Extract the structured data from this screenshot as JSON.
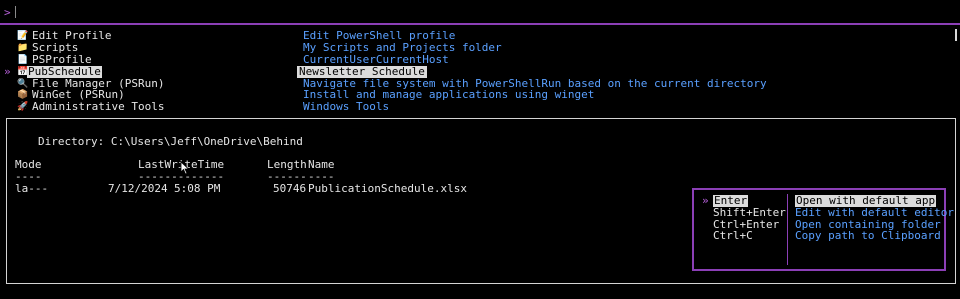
{
  "prompt": {
    "symbol": ">",
    "value": ""
  },
  "entries": [
    {
      "icon": "📝",
      "icon_name": "memo-icon",
      "name": "Edit Profile",
      "description": "Edit PowerShell profile",
      "selected": false
    },
    {
      "icon": "📁",
      "icon_name": "folder-icon",
      "name": "Scripts",
      "description": "My Scripts and Projects folder",
      "selected": false
    },
    {
      "icon": "📄",
      "icon_name": "page-icon",
      "name": "PSProfile",
      "description": "CurrentUserCurrentHost",
      "selected": false
    },
    {
      "icon": "📅",
      "icon_name": "calendar-icon",
      "name": "PubSchedule",
      "description": "Newsletter Schedule",
      "selected": true
    },
    {
      "icon": "🔍",
      "icon_name": "magnifier-icon",
      "name": "File Manager (PSRun)",
      "description": "Navigate file system with PowerShellRun based on the current directory",
      "selected": false
    },
    {
      "icon": "📦",
      "icon_name": "package-icon",
      "name": "WinGet (PSRun)",
      "description": "Install and manage applications using winget",
      "selected": false
    },
    {
      "icon": "🚀",
      "icon_name": "rocket-icon",
      "name": "Administrative Tools",
      "description": "Windows Tools",
      "selected": false
    }
  ],
  "selection_marker": "»",
  "preview": {
    "directory_label": "Directory: C:\\Users\\Jeff\\OneDrive\\Behind",
    "headers": {
      "mode": "Mode",
      "lastwrite": "LastWriteTime",
      "length": "Length",
      "name": "Name"
    },
    "separators": {
      "mode": "----",
      "lastwrite": "-------------",
      "length": "------",
      "name": "----"
    },
    "rows": [
      {
        "mode": "la---",
        "date": "7/12/2024",
        "time": "5:08 PM",
        "length": "50746",
        "name": "PublicationSchedule.xlsx"
      }
    ]
  },
  "actions": [
    {
      "key": "Enter",
      "label": "Open with default app",
      "selected": true
    },
    {
      "key": "Shift+Enter",
      "label": "Edit with default editor",
      "selected": false
    },
    {
      "key": "Ctrl+Enter",
      "label": "Open containing folder",
      "selected": false
    },
    {
      "key": "Ctrl+C",
      "label": "Copy path to Clipboard",
      "selected": false
    }
  ],
  "colors": {
    "accent": "#8b3fb6",
    "description": "#5aa0ff",
    "selection_bg": "#dcdcdc",
    "background": "#000000"
  }
}
